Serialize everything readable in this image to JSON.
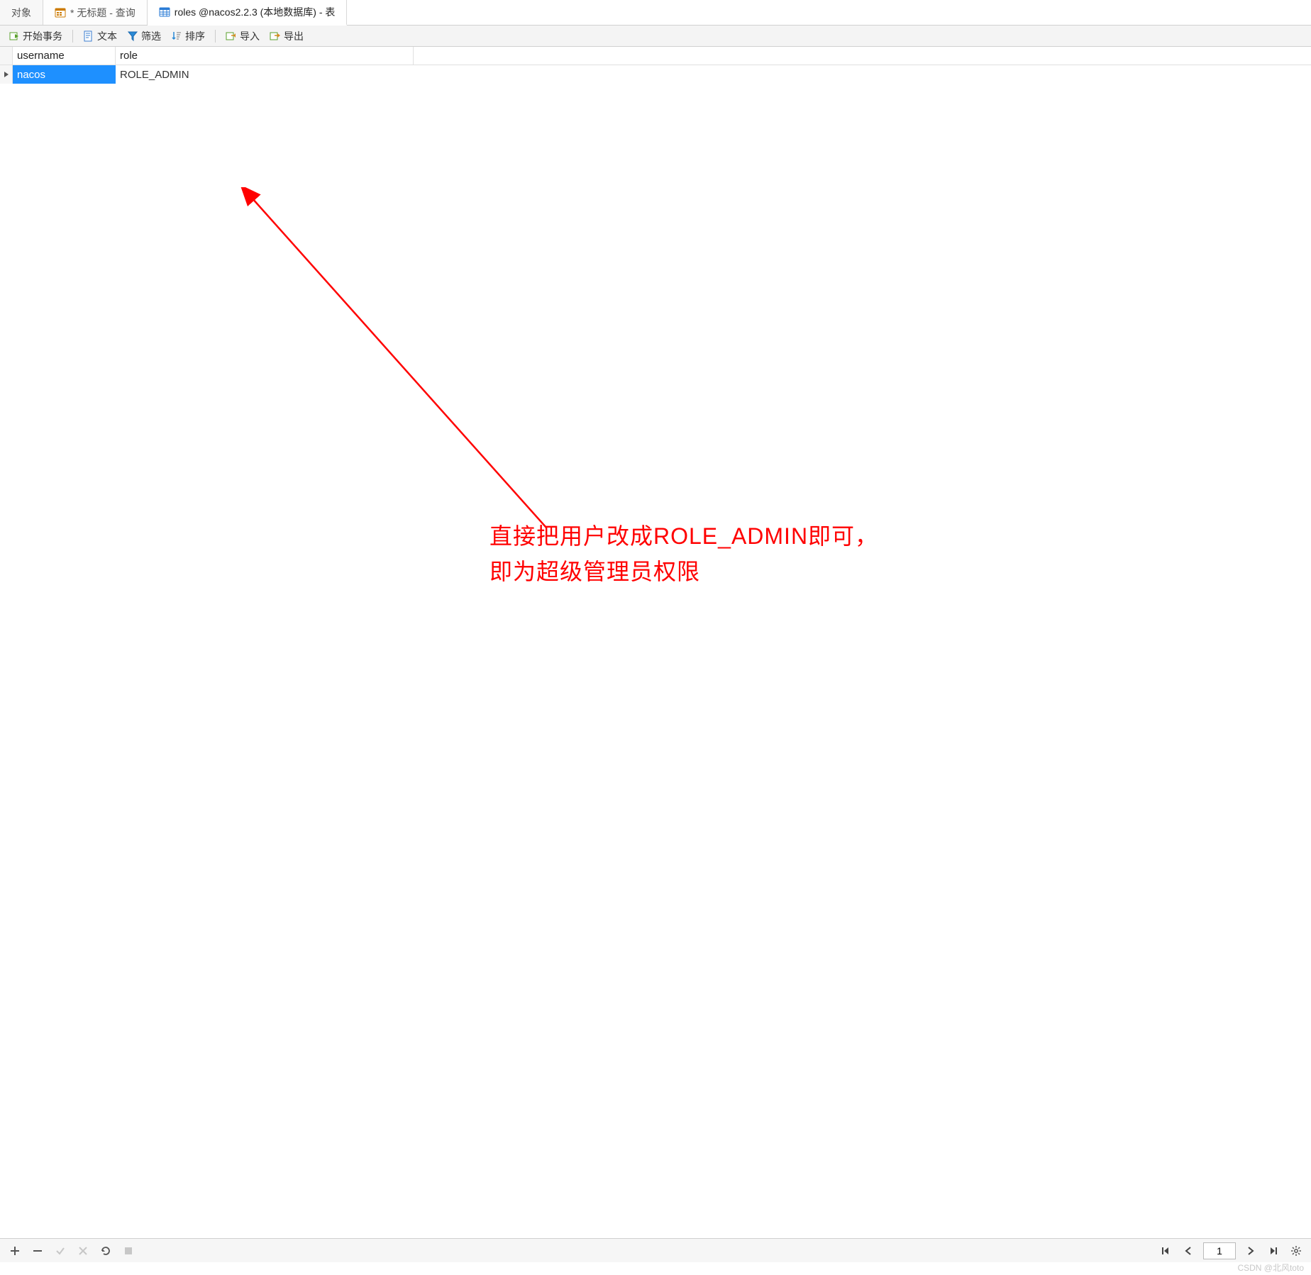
{
  "tabs": {
    "objects": "对象",
    "query": "* 无标题 - 查询",
    "roles": "roles @nacos2.2.3 (本地数据库) - 表"
  },
  "toolbar": {
    "begin_tx": "开始事务",
    "text": "文本",
    "filter": "筛选",
    "sort": "排序",
    "import": "导入",
    "export": "导出"
  },
  "columns": {
    "username": "username",
    "role": "role"
  },
  "rows": [
    {
      "username": "nacos",
      "role": "ROLE_ADMIN"
    }
  ],
  "annotation": {
    "line1": "直接把用户改成ROLE_ADMIN即可，",
    "line2": "即为超级管理员权限"
  },
  "pager": {
    "page": "1"
  },
  "watermark": "CSDN @北风toto"
}
